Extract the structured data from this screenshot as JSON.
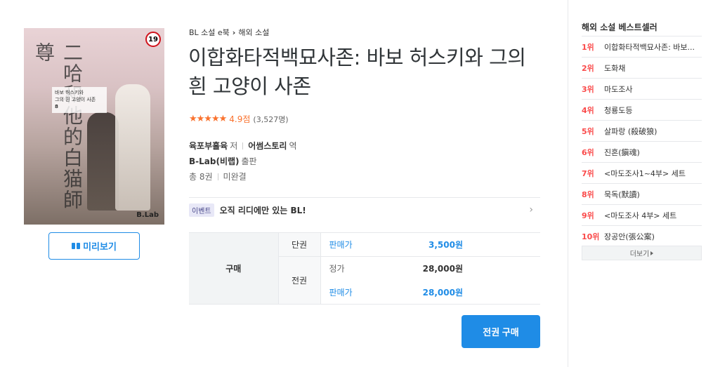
{
  "cover": {
    "badge": "19",
    "vertical_text": "二哈和他的白猫師尊",
    "title_box_line1": "바보 허스키와",
    "title_box_line2": "그의 흰 고양이 사존",
    "title_box_line3": "8",
    "brand": "B.Lab"
  },
  "preview": {
    "label": "미리보기"
  },
  "breadcrumb": {
    "category": "BL 소설 e북",
    "subcategory": "해외 소설"
  },
  "book": {
    "title": "이합화타적백묘사존: 바보 허스키와 그의 흰 고양이 사존",
    "stars": "★★★★★",
    "rating": "4.9점",
    "rating_count": "(3,527명)",
    "author": "육포부흘육",
    "author_role": "저",
    "translator": "어썸스토리",
    "translator_role": "역",
    "publisher": "B-Lab(비랩)",
    "publisher_role": "출판",
    "volumes": "총 8권",
    "status": "미완결"
  },
  "event": {
    "tag": "이벤트",
    "text": "오직 리디에만 있는 BL!",
    "chevron": "›"
  },
  "price": {
    "buy_label": "구매",
    "single_label": "단권",
    "single_price_label": "판매가",
    "single_price": "3,500원",
    "set_label": "전권",
    "list_price_label": "정가",
    "list_price": "28,000원",
    "set_price_label": "판매가",
    "set_price": "28,000원"
  },
  "buy_button": {
    "label": "전권 구매"
  },
  "bestseller": {
    "title": "해외 소설 베스트셀러",
    "items": [
      {
        "rank": "1위",
        "name": "이합화타적백묘사존: 바보..."
      },
      {
        "rank": "2위",
        "name": "도화채"
      },
      {
        "rank": "3위",
        "name": "마도조사"
      },
      {
        "rank": "4위",
        "name": "청룡도등"
      },
      {
        "rank": "5위",
        "name": "살파랑 (殺破狼)"
      },
      {
        "rank": "6위",
        "name": "진혼(鎭魂)"
      },
      {
        "rank": "7위",
        "name": "<마도조사1~4부> 세트"
      },
      {
        "rank": "8위",
        "name": "묵독(默讀)"
      },
      {
        "rank": "9위",
        "name": "<마도조사 4부> 세트"
      },
      {
        "rank": "10위",
        "name": "장공안(張公案)"
      }
    ],
    "more_label": "더보기"
  },
  "colors": {
    "accent": "#1f8ce6",
    "rating": "#fa722e",
    "rank": "#fa4a4a"
  }
}
